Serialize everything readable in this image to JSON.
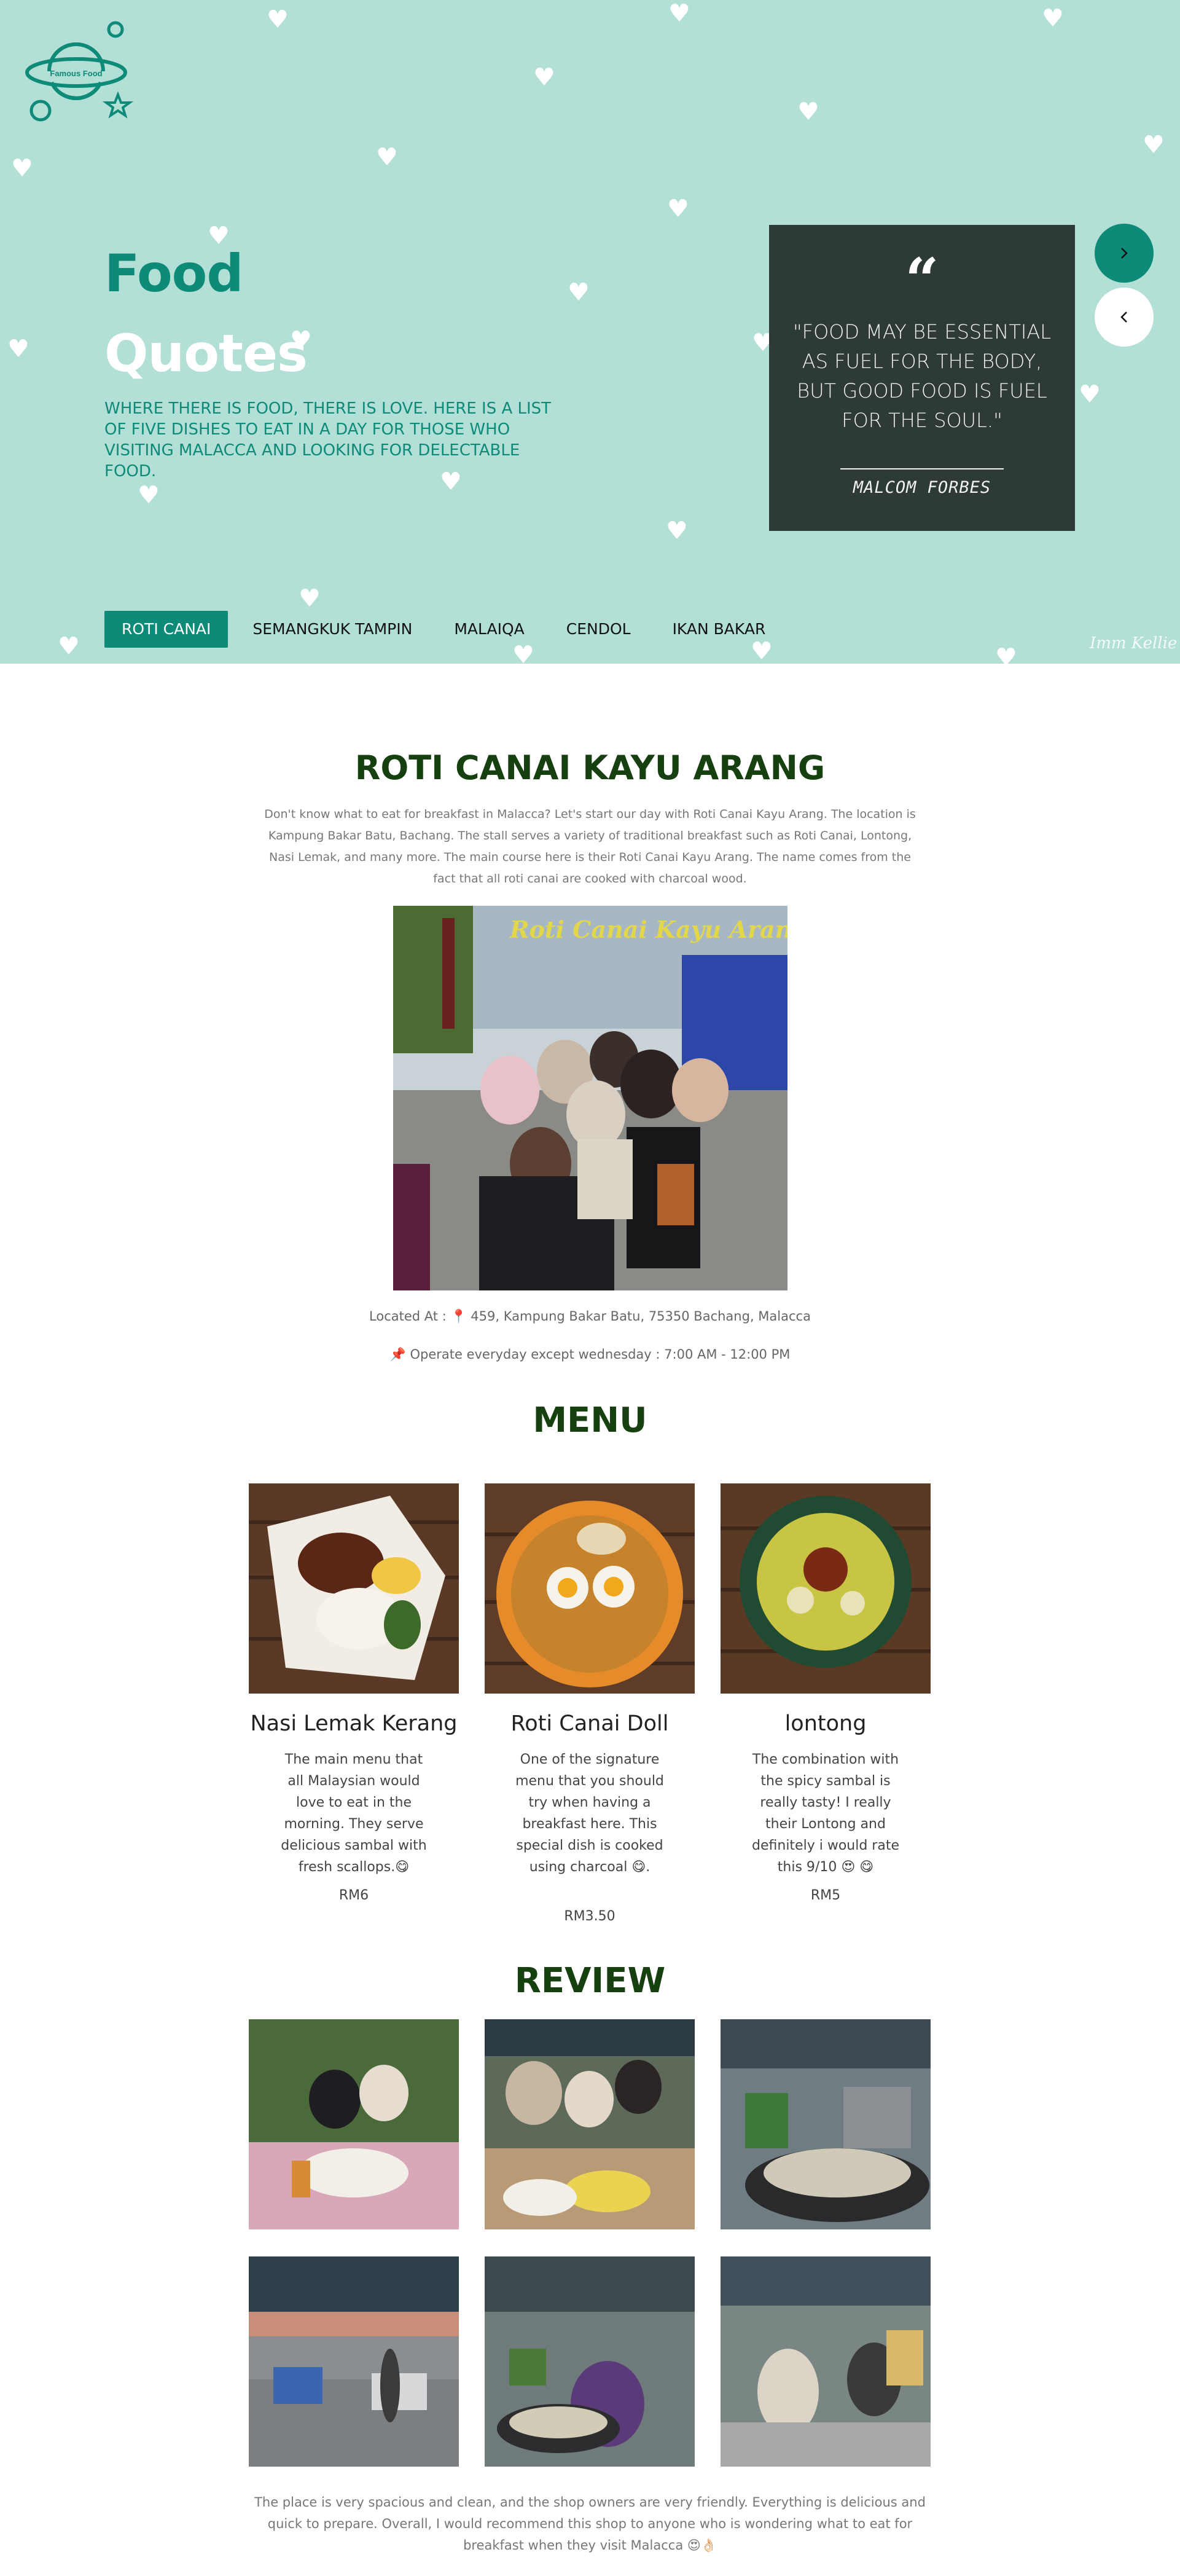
{
  "brand": {
    "logo_text": "Famous Food",
    "logo_icon": "planet-icon"
  },
  "hero": {
    "title_line1": "Food",
    "title_line2": "Quotes",
    "subtitle": "Where there is food, there is love. Here is a list of five dishes to eat in a day for those who visiting Malacca and looking for delectable food.",
    "quote": {
      "mark": "“",
      "text": "\"Food may be essential as fuel for the body, but good food is fuel for the soul.\"",
      "author": "MALCOM FORBES"
    },
    "signature": "Imm Kellie",
    "next_icon": "chevron-right-icon",
    "prev_icon": "chevron-left-icon"
  },
  "tabs": [
    {
      "label": "ROTI CANAI",
      "active": true
    },
    {
      "label": "SEMANGKUK TAMPIN",
      "active": false
    },
    {
      "label": "MALAIQA",
      "active": false
    },
    {
      "label": "CENDOL",
      "active": false
    },
    {
      "label": "IKAN BAKAR",
      "active": false
    }
  ],
  "place": {
    "title": "ROTI CANAI KAYU ARANG",
    "intro": "Don't know what to eat for breakfast in Malacca? Let's start our day with Roti Canai Kayu Arang. The location is Kampung Bakar Batu, Bachang. The stall serves a variety of traditional breakfast such as Roti Canai, Lontong, Nasi Lemak, and many more. The main course here is their Roti Canai Kayu Arang. The name comes from the fact that all roti canai are cooked with charcoal wood.",
    "photo_sign": "Roti Canai Kayu Arang Bachang",
    "location_label": "Located At :",
    "location": "459, Kampung Bakar Batu, 75350 Bachang, Malacca",
    "hours": "Operate everyday except wednesday : 7:00 AM - 12:00 PM"
  },
  "menu": {
    "title": "MENU",
    "items": [
      {
        "name": "Nasi Lemak Kerang",
        "desc": "The main menu that all Malaysian would love to eat in the morning. They serve delicious sambal with fresh scallops.😋",
        "price": "RM6"
      },
      {
        "name": "Roti Canai Doll",
        "desc": "One of the signature menu that you should try when having a breakfast here. This special dish is cooked using charcoal 😋.",
        "price": "RM3.50"
      },
      {
        "name": "lontong",
        "desc": "The combination with the spicy sambal is really tasty! I really their Lontong and definitely i would rate this 9/10 😍 😋",
        "price": "RM5"
      }
    ]
  },
  "review": {
    "title": "REVIEW",
    "text": "The place is very spacious and clean, and the shop owners are very friendly. Everything is delicious and quick to prepare. Overall, I would recommend this shop to anyone who is wondering what to eat for breakfast when they visit Malacca 😍👌🏻"
  },
  "colors": {
    "hero_bg": "#b3e0d6",
    "accent": "#0d8a78",
    "quote_bg": "#2e3a38",
    "title_green": "#16400f"
  }
}
